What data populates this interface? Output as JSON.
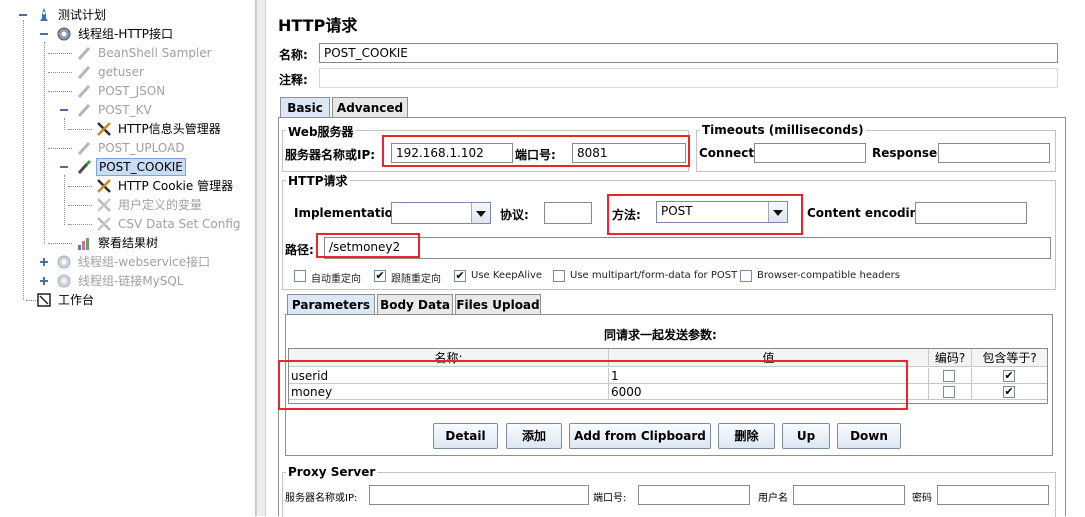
{
  "tree": {
    "root": "测试计划",
    "thread_group_http": "线程组-HTTP接口",
    "items": {
      "beanshell": "BeanShell Sampler",
      "getuser": "getuser",
      "post_json": "POST_JSON",
      "post_kv": "POST_KV",
      "header_manager": "HTTP信息头管理器",
      "post_upload": "POST_UPLOAD",
      "post_cookie": "POST_COOKIE",
      "cookie_manager": "HTTP Cookie 管理器",
      "user_vars": "用户定义的变量",
      "csv_config": "CSV Data Set Config",
      "result_tree": "察看结果树"
    },
    "thread_group_ws": "线程组-webservice接口",
    "thread_group_mysql": "线程组-链接MySQL",
    "workbench": "工作台"
  },
  "panel": {
    "title": "HTTP请求",
    "name_label": "名称:",
    "name_value": "POST_COOKIE",
    "comment_label": "注释:",
    "comment_value": "",
    "tabs": [
      "Basic",
      "Advanced"
    ],
    "web_server": {
      "title": "Web服务器",
      "server_label": "服务器名称或IP:",
      "server_value": "192.168.1.102",
      "port_label": "端口号:",
      "port_value": "8081"
    },
    "timeouts": {
      "title": "Timeouts (milliseconds)",
      "connect_label": "Connect:",
      "connect_value": "",
      "response_label": "Response:",
      "response_value": ""
    },
    "http_request": {
      "title": "HTTP请求",
      "implementation_label": "Implementation:",
      "implementation_value": "",
      "protocol_label": "协议:",
      "protocol_value": "",
      "method_label": "方法:",
      "method_value": "POST",
      "encoding_label": "Content encoding:",
      "encoding_value": "",
      "path_label": "路径:",
      "path_value": "/setmoney2"
    },
    "options": [
      {
        "label": "自动重定向",
        "checked": false
      },
      {
        "label": "跟随重定向",
        "checked": true
      },
      {
        "label": "Use KeepAlive",
        "checked": true
      },
      {
        "label": "Use multipart/form-data for POST",
        "checked": false
      },
      {
        "label": "Browser-compatible headers",
        "checked": false
      }
    ],
    "subtabs": [
      "Parameters",
      "Body Data",
      "Files Upload"
    ],
    "params": {
      "caption": "同请求一起发送参数:",
      "headers": [
        "名称:",
        "值",
        "编码?",
        "包含等于?"
      ],
      "rows": [
        {
          "name": "userid",
          "value": "1",
          "encode": false,
          "include_equals": true
        },
        {
          "name": "money",
          "value": "6000",
          "encode": false,
          "include_equals": true
        }
      ],
      "buttons": [
        "Detail",
        "添加",
        "Add from Clipboard",
        "删除",
        "Up",
        "Down"
      ]
    },
    "proxy": {
      "title": "Proxy Server",
      "server_label": "服务器名称或IP:",
      "port_label": "端口号:",
      "user_label": "用户名",
      "password_label": "密码"
    }
  },
  "colors": {
    "highlight": "#e8272b",
    "selection": "#c9dcf3"
  }
}
